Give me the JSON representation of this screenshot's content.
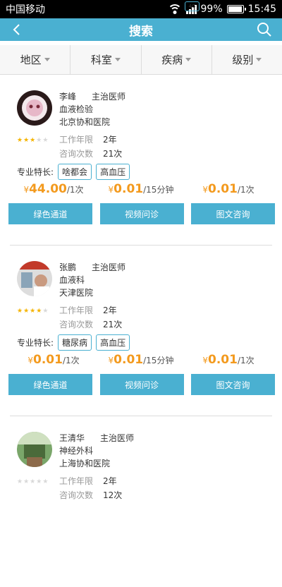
{
  "status": {
    "carrier": "中国移动",
    "net": "4G",
    "battery": "99%",
    "time": "15:45"
  },
  "nav": {
    "title": "搜索"
  },
  "filters": [
    "地区",
    "科室",
    "疾病",
    "级别"
  ],
  "labels": {
    "years": "工作年限",
    "consults": "咨询次数",
    "specialty": "专业特长:",
    "currency": "¥"
  },
  "buttons": {
    "green": "绿色通道",
    "video": "视频问诊",
    "text": "图文咨询"
  },
  "doctors": [
    {
      "name": "李峰",
      "title": "主治医师",
      "dept": "血液检验",
      "hospital": "北京协和医院",
      "rating": 3,
      "years": "2年",
      "consults": "21次",
      "tags": [
        "啥都会",
        "高血压"
      ],
      "prices": [
        {
          "value": "44.00",
          "unit": "/1次"
        },
        {
          "value": "0.01",
          "unit": "/15分钟"
        },
        {
          "value": "0.01",
          "unit": "/1次"
        }
      ]
    },
    {
      "name": "张鹏",
      "title": "主治医师",
      "dept": "血液科",
      "hospital": "天津医院",
      "rating": 4,
      "years": "2年",
      "consults": "21次",
      "tags": [
        "糖尿病",
        "高血压"
      ],
      "prices": [
        {
          "value": "0.01",
          "unit": "/1次"
        },
        {
          "value": "0.01",
          "unit": "/15分钟"
        },
        {
          "value": "0.01",
          "unit": "/1次"
        }
      ]
    },
    {
      "name": "王清华",
      "title": "主治医师",
      "dept": "神经外科",
      "hospital": "上海协和医院",
      "rating": 0,
      "years": "2年",
      "consults": "12次",
      "tags": [],
      "prices": []
    }
  ],
  "colors": {
    "accent": "#4ab0d1",
    "price": "#f39a1e",
    "star": "#f5b400"
  }
}
